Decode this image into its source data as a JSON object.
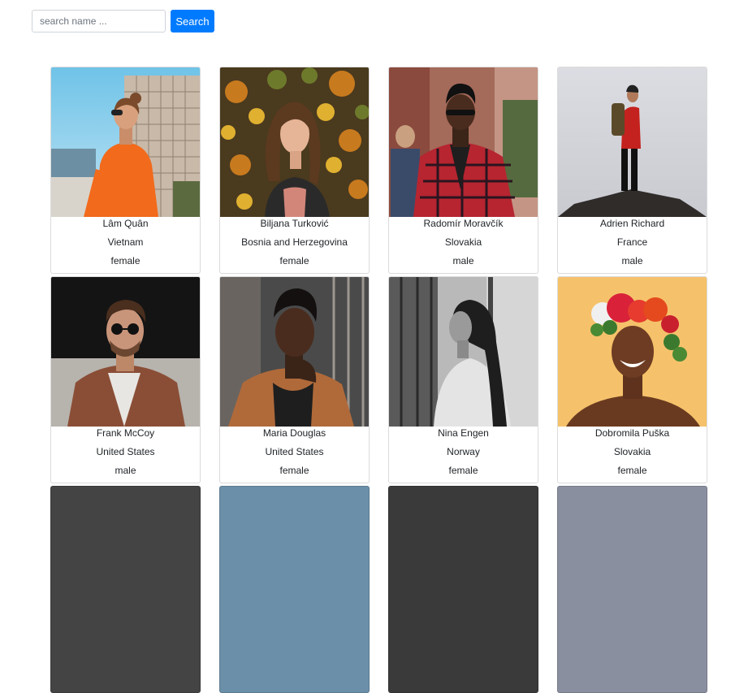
{
  "search": {
    "placeholder": "search name ...",
    "value": "",
    "button_label": "Search"
  },
  "people": [
    {
      "name": "Lâm Quân",
      "country": "Vietnam",
      "gender": "female",
      "photo": "woman-orange-shirt-sunglasses"
    },
    {
      "name": "Biljana Turković",
      "country": "Bosnia and Herzegovina",
      "gender": "female",
      "photo": "woman-autumn-leaves"
    },
    {
      "name": "Radomír Moravčík",
      "country": "Slovakia",
      "gender": "male",
      "photo": "man-plaid-shirt-sunglasses"
    },
    {
      "name": "Adrien Richard",
      "country": "France",
      "gender": "male",
      "photo": "hiker-on-rock"
    },
    {
      "name": "Frank McCoy",
      "country": "United States",
      "gender": "male",
      "photo": "man-sunglasses-brown-jacket"
    },
    {
      "name": "Maria Douglas",
      "country": "United States",
      "gender": "female",
      "photo": "woman-short-hair-window"
    },
    {
      "name": "Nina Engen",
      "country": "Norway",
      "gender": "female",
      "photo": "woman-black-and-white"
    },
    {
      "name": "Dobromila Puška",
      "country": "Slovakia",
      "gender": "female",
      "photo": "woman-flower-crown"
    }
  ]
}
